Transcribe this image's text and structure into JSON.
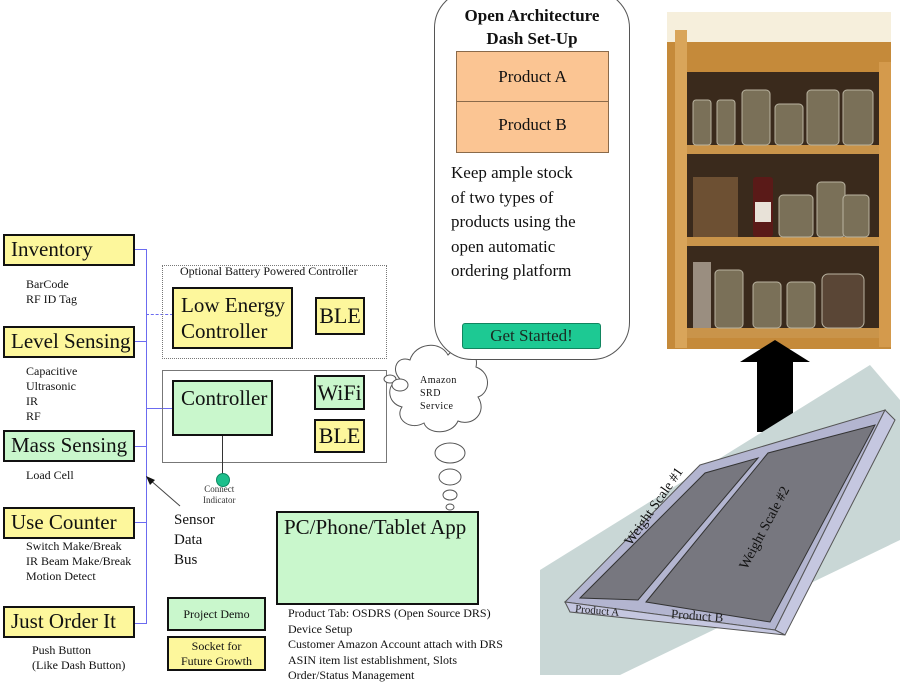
{
  "categories": [
    {
      "label": "Inventory",
      "color": "#fdf79c",
      "items": [
        "BarCode",
        "RF ID Tag"
      ]
    },
    {
      "label": "Level Sensing",
      "color": "#fdf79c",
      "items": [
        "Capacitive",
        "Ultrasonic",
        "IR",
        "RF"
      ]
    },
    {
      "label": "Mass Sensing",
      "color": "#c9f7cc",
      "items": [
        "Load Cell"
      ]
    },
    {
      "label": "Use Counter",
      "color": "#fdf79c",
      "items": [
        "Switch Make/Break",
        "IR Beam Make/Break",
        "Motion Detect"
      ]
    },
    {
      "label": "Just Order It",
      "color": "#fdf79c",
      "items": [
        "Push Button",
        "(Like Dash Button)"
      ]
    }
  ],
  "optional_controller": {
    "title": "Optional Battery Powered Controller",
    "low_energy": [
      "Low Energy",
      "Controller"
    ],
    "ble": "BLE"
  },
  "main_controller": {
    "label": "Controller",
    "wifi": "WiFi",
    "ble": "BLE",
    "indicator": [
      "Connect",
      "Indicator"
    ],
    "indicator_color": "#1dbf8c"
  },
  "cloud": {
    "lines": [
      "Amazon",
      "SRD",
      "Service"
    ]
  },
  "sensor_bus": [
    "Sensor",
    "Data",
    "Bus"
  ],
  "app": {
    "label": "PC/Phone/Tablet App",
    "features": [
      "Product Tab: OSDRS (Open Source DRS)",
      "Device Setup",
      "Customer Amazon Account attach with DRS",
      "ASIN item list establishment, Slots",
      "Order/Status Management"
    ]
  },
  "legend": {
    "demo": "Project Demo",
    "future": [
      "Socket for",
      "Future Growth"
    ],
    "demo_color": "#c9f7cc",
    "future_color": "#fdf79c"
  },
  "phone_mock": {
    "title": [
      "Open Architecture",
      "Dash Set-Up"
    ],
    "products": [
      "Product A",
      "Product B"
    ],
    "product_color": "#fbc593",
    "description": [
      "Keep ample stock",
      "of two types of",
      "products using the",
      "open automatic",
      "ordering platform"
    ],
    "cta": "Get Started!",
    "cta_color": "#1dc993"
  },
  "scale_model": {
    "scales": [
      "Weight Scale #1",
      "Weight Scale #2"
    ],
    "products": [
      "Product A",
      "Product B"
    ]
  }
}
